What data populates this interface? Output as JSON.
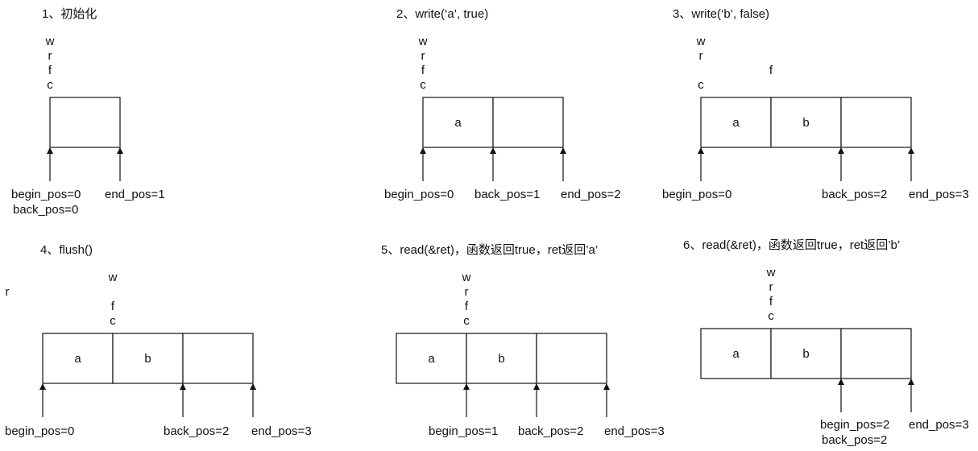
{
  "steps": [
    {
      "title": "1、初始化",
      "cells": [
        ""
      ],
      "letters": {
        "w": 0,
        "r": 0,
        "f": 0,
        "c": 0
      },
      "pointers": [
        {
          "label": "begin_pos=0",
          "pos": 0
        },
        {
          "label": "end_pos=1",
          "pos": 1
        },
        {
          "label": "back_pos=0",
          "pos": 0
        }
      ]
    },
    {
      "title": "2、write(‘a’, true)",
      "cells": [
        "a",
        ""
      ],
      "letters": {
        "w": 0,
        "r": 0,
        "f": 0,
        "c": 0
      },
      "pointers": [
        {
          "label": "begin_pos=0",
          "pos": 0
        },
        {
          "label": "back_pos=1",
          "pos": 1
        },
        {
          "label": "end_pos=2",
          "pos": 2
        }
      ]
    },
    {
      "title": "3、write(‘b’, false)",
      "cells": [
        "a",
        "b",
        ""
      ],
      "letters": {
        "w": 0,
        "r": 0,
        "f": 1,
        "c": 0
      },
      "pointers": [
        {
          "label": "begin_pos=0",
          "pos": 0
        },
        {
          "label": "back_pos=2",
          "pos": 2
        },
        {
          "label": "end_pos=3",
          "pos": 3
        }
      ]
    },
    {
      "title": "4、flush()",
      "cells": [
        "a",
        "b",
        ""
      ],
      "letters": {
        "w": 1,
        "r": 0,
        "f": 1,
        "c": 1
      },
      "pointers": [
        {
          "label": "begin_pos=0",
          "pos": 0
        },
        {
          "label": "back_pos=2",
          "pos": 2
        },
        {
          "label": "end_pos=3",
          "pos": 3
        }
      ]
    },
    {
      "title": "5、read(&ret)，函数返回true，ret返回’a’",
      "cells": [
        "a",
        "b",
        ""
      ],
      "letters": {
        "w": 1,
        "r": 1,
        "f": 1,
        "c": 1
      },
      "pointers": [
        {
          "label": "begin_pos=1",
          "pos": 1
        },
        {
          "label": "back_pos=2",
          "pos": 2
        },
        {
          "label": "end_pos=3",
          "pos": 3
        }
      ]
    },
    {
      "title": "6、read(&ret)，函数返回true，ret返回’b’",
      "cells": [
        "a",
        "b",
        ""
      ],
      "letters": {
        "w": 1,
        "r": 1,
        "f": 1,
        "c": 1
      },
      "pointers": [
        {
          "label": "begin_pos=2",
          "pos": 2
        },
        {
          "label": "end_pos=3",
          "pos": 3
        },
        {
          "label": "back_pos=2",
          "pos": 2
        }
      ]
    }
  ]
}
